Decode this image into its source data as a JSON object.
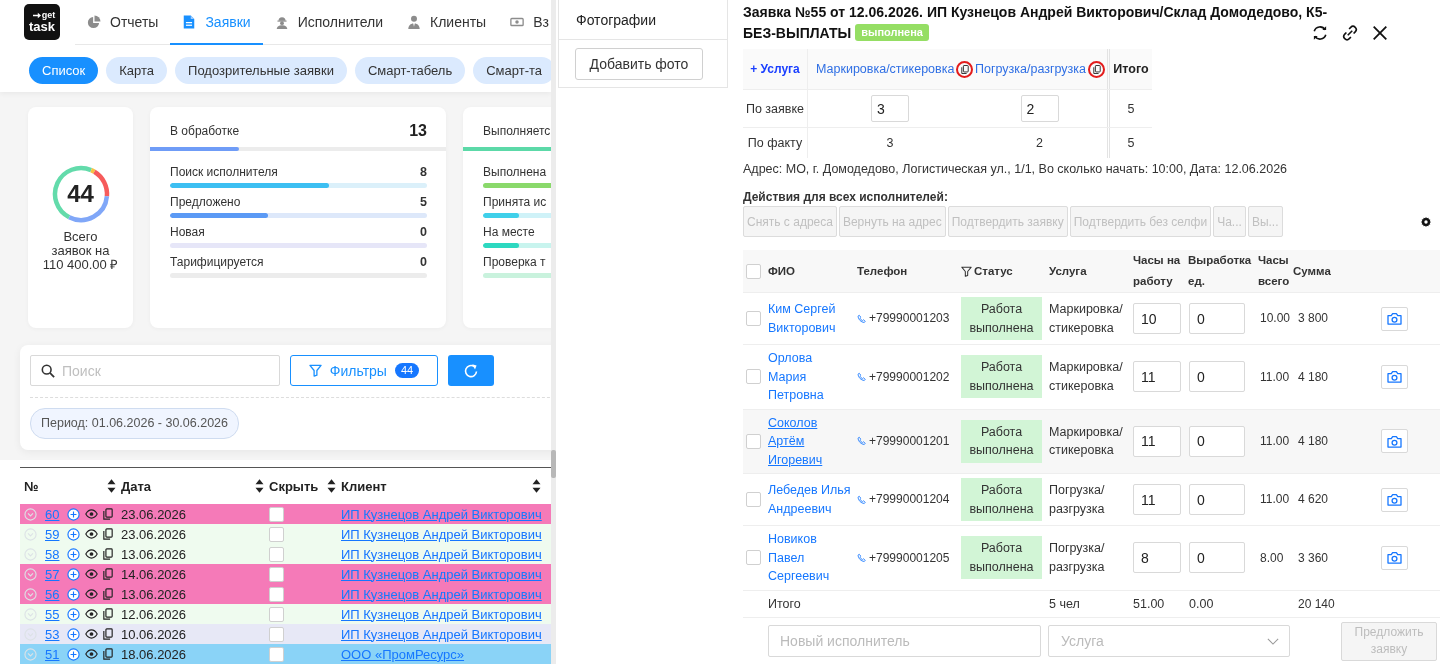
{
  "app": {
    "logo": {
      "top": "get",
      "bottom": "task"
    },
    "nav": [
      {
        "label": "Отчеты",
        "selected": false
      },
      {
        "label": "Заявки",
        "selected": true
      },
      {
        "label": "Исполнители",
        "selected": false
      },
      {
        "label": "Клиенты",
        "selected": false
      },
      {
        "label": "Вз",
        "selected": false
      }
    ],
    "views": [
      {
        "label": "Список",
        "selected": true
      },
      {
        "label": "Карта",
        "selected": false
      },
      {
        "label": "Подозрительные заявки",
        "selected": false
      },
      {
        "label": "Смарт-табель",
        "selected": false
      },
      {
        "label": "Смарт-та",
        "selected": false
      }
    ],
    "summary": {
      "total": "44",
      "caption": "Всего заявок на 110 400.00 ₽"
    },
    "status_cards": [
      {
        "title": "В обработке",
        "count": "13",
        "level": 0.3,
        "color": "#6f9cf7",
        "items": [
          {
            "label": "Поиск исполнителя",
            "count": "8",
            "level": 0.62,
            "color": "#3cbff2",
            "track": {
              "color": "#dbf0fa"
            }
          },
          {
            "label": "Предложено",
            "count": "5",
            "level": 0.38,
            "color": "#5b9af5",
            "track": {
              "color": "#dde8fa"
            }
          },
          {
            "label": "Новая",
            "count": "0",
            "track": {
              "color": "#e6e6f8"
            }
          },
          {
            "label": "Тарифицируется",
            "count": "0",
            "track": {
              "color": "#ececec"
            }
          }
        ]
      },
      {
        "title": "Выполняетс",
        "color": "#5cd9a8",
        "items": [
          {
            "label": "Выполнена",
            "color": "#8ad96b"
          },
          {
            "label": "Принята ис",
            "level": 0.14,
            "color": "#3fd0ea",
            "track": {
              "color": "#cff2f8"
            }
          },
          {
            "label": "На месте",
            "level": 0.14,
            "color": "#2dd8c0",
            "track": {
              "color": "#c8f4ee"
            }
          },
          {
            "label": "Проверка т",
            "track": {
              "color": "#c9f2dd"
            }
          }
        ]
      }
    ],
    "search": {
      "placeholder": "Поиск"
    },
    "filters": {
      "label": "Фильтры",
      "badge": "44"
    },
    "period": "Период: 01.06.2026 - 30.06.2026",
    "table": {
      "columns": [
        "№",
        "Дата",
        "Скрыть",
        "Клиент"
      ],
      "rows": [
        {
          "number": "60",
          "date": "23.06.2026",
          "hidden": false,
          "client": "ИП Кузнецов Андрей Викторович",
          "color": "#f57ab8"
        },
        {
          "number": "59",
          "date": "23.06.2026",
          "hidden": false,
          "client": "ИП Кузнецов Андрей Викторович",
          "color": "#effbef"
        },
        {
          "number": "58",
          "date": "13.06.2026",
          "hidden": false,
          "client": "ИП Кузнецов Андрей Викторович",
          "color": "#effbef"
        },
        {
          "number": "57",
          "date": "14.06.2026",
          "hidden": false,
          "client": "ИП Кузнецов Андрей Викторович",
          "color": "#f57ab8"
        },
        {
          "number": "56",
          "date": "13.06.2026",
          "hidden": false,
          "client": "ИП Кузнецов Андрей Викторович",
          "color": "#f57ab8"
        },
        {
          "number": "55",
          "date": "12.06.2026",
          "hidden": false,
          "client": "ИП Кузнецов Андрей Викторович",
          "color": "#effbef"
        },
        {
          "number": "53",
          "date": "10.06.2026",
          "hidden": false,
          "client": "ИП Кузнецов Андрей Викторович",
          "color": "#e7e8f6"
        },
        {
          "number": "51",
          "date": "18.06.2026",
          "hidden": false,
          "client": "ООО «ПромРесурс»",
          "color": "#8ad3f7"
        }
      ]
    }
  },
  "drawer": {
    "photos": {
      "title": "Фотографии",
      "button": "Добавить фото"
    },
    "title_lines": [
      "Заявка №55 от 12.06.2026. ИП Кузнецов Андрей Викторович/Склад Домодедово, К5-",
      "БЕЗ-ВЫПЛАТЫ"
    ],
    "status": "выполнена",
    "services": {
      "add": "+ Услуга",
      "columns": [
        "Маркировка/стикеровка",
        "Погрузка/разгрузка"
      ],
      "total": "Итого",
      "rows": [
        {
          "label": "По заявке",
          "kind": "input",
          "values": [
            "3",
            "2"
          ],
          "total": "5"
        },
        {
          "label": "По факту",
          "kind": "text",
          "values": [
            "3",
            "2"
          ],
          "total": "5"
        }
      ]
    },
    "address": "Адрес: МО, г. Домодедово, Логистическая ул., 1/1, Во сколько начать: 10:00, Дата: 12.06.2026",
    "bulk": {
      "title": "Действия для всех исполнителей:",
      "buttons": [
        {
          "label": "Снять с адреса",
          "disabled": true
        },
        {
          "label": "Вернуть на адрес",
          "disabled": true
        },
        {
          "label": "Подтвердить заявку",
          "disabled": true
        },
        {
          "label": "Подтвердить без селфи",
          "disabled": true
        },
        {
          "label": "Ча...",
          "disabled": true
        },
        {
          "label": "Вы...",
          "disabled": true
        }
      ]
    },
    "workers": {
      "all_checked": false,
      "columns": [
        "ФИО",
        "Телефон",
        "Статус",
        "Услуга",
        "Часы на работу",
        "Выработка ед.",
        "Часы всего",
        "Сумма"
      ],
      "rows": [
        {
          "checked": false,
          "highlighted": false,
          "name": "Ким Сергей Викторович",
          "phone": "+79990001203",
          "status": "Работа выполнена",
          "service": "Маркировка/стикеровка",
          "hours": "10",
          "output": "0",
          "hours_total": "10.00",
          "sum": "3 800"
        },
        {
          "checked": false,
          "highlighted": false,
          "name": "Орлова Мария Петровна",
          "phone": "+79990001202",
          "status": "Работа выполнена",
          "service": "Маркировка/стикеровка",
          "hours": "11",
          "output": "0",
          "hours_total": "11.00",
          "sum": "4 180"
        },
        {
          "checked": false,
          "highlighted": true,
          "name": "Соколов Артём Игоревич",
          "phone": "+79990001201",
          "status": "Работа выполнена",
          "service": "Маркировка/стикеровка",
          "hours": "11",
          "output": "0",
          "hours_total": "11.00",
          "sum": "4 180"
        },
        {
          "checked": false,
          "highlighted": false,
          "name": "Лебедев Илья Андреевич",
          "phone": "+79990001204",
          "status": "Работа выполнена",
          "service": "Погрузка/разгрузка",
          "hours": "11",
          "output": "0",
          "hours_total": "11.00",
          "sum": "4 620"
        },
        {
          "checked": false,
          "highlighted": false,
          "name": "Новиков Павел Сергеевич",
          "phone": "+79990001205",
          "status": "Работа выполнена",
          "service": "Погрузка/разгрузка",
          "hours": "8",
          "output": "0",
          "hours_total": "8.00",
          "sum": "3 360"
        }
      ],
      "totals": {
        "label": "Итого",
        "people": "5 чел",
        "hours": "51.00",
        "output": "0.00",
        "sum": "20 140"
      },
      "new_worker": {
        "placeholder": "Новый исполнитель"
      },
      "service_select": {
        "placeholder": "Услуга"
      },
      "propose": {
        "label": "Предложить заявку",
        "disabled": true
      }
    }
  }
}
